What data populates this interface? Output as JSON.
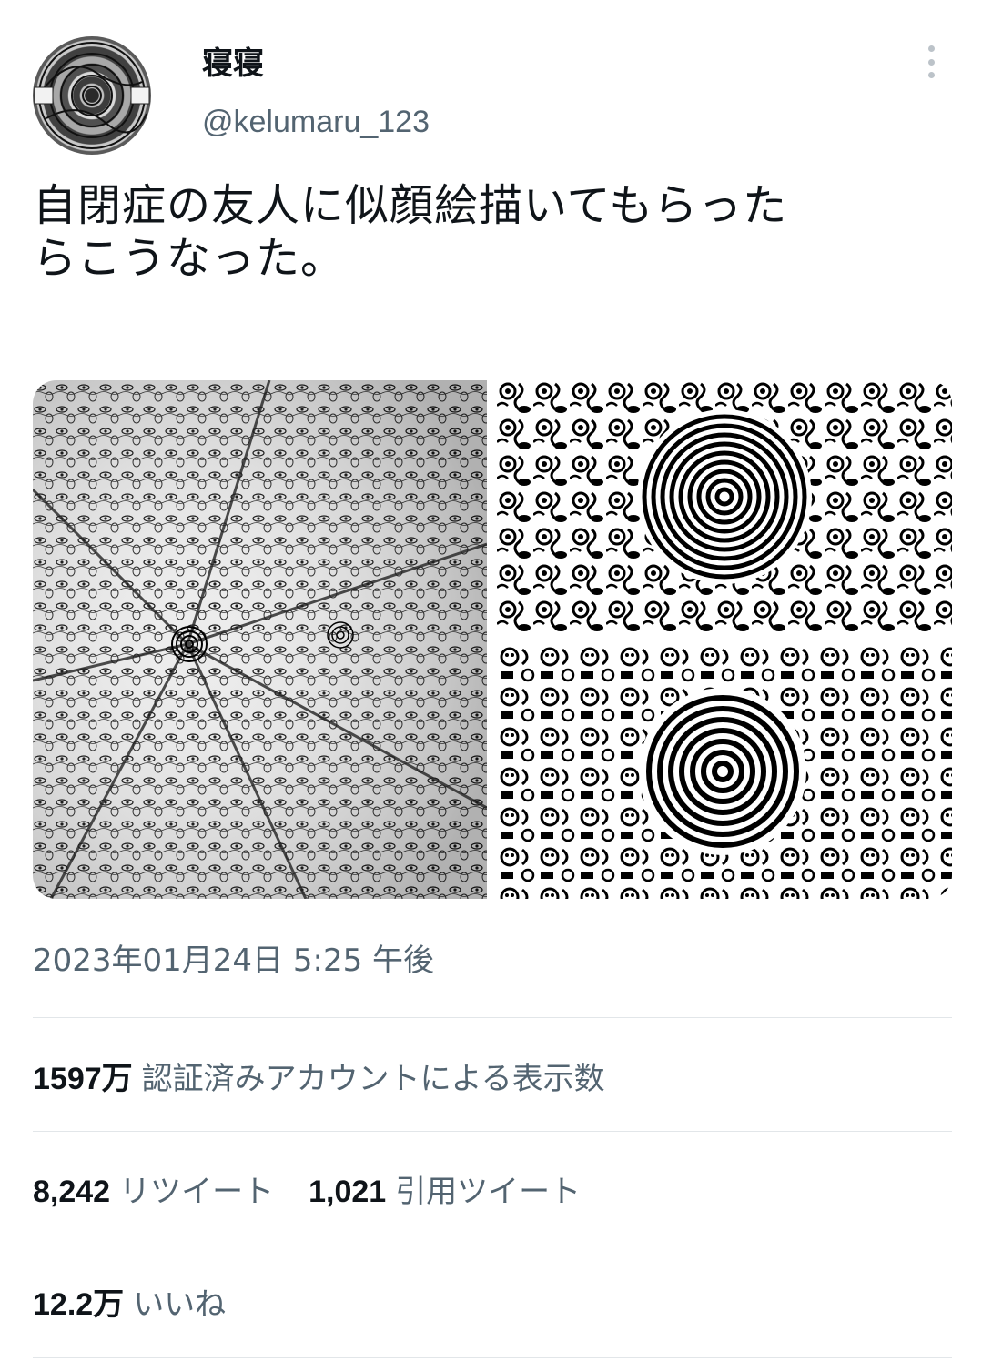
{
  "user": {
    "display_name": "寝寝",
    "handle": "@kelumaru_123"
  },
  "tweet": {
    "text_lines": [
      "自閉症の友人に似顔絵描いてもらった",
      "らこうなった。"
    ]
  },
  "media": [
    {
      "description_icon": "drawing-full-view"
    },
    {
      "description_icon": "drawing-spiral-closeup-1"
    },
    {
      "description_icon": "drawing-spiral-closeup-2"
    }
  ],
  "timestamp": "2023年01月24日 5:25 午後",
  "stats": {
    "views_count": "1597万",
    "views_label": "認証済みアカウントによる表示数",
    "retweets_count": "8,242",
    "retweets_label": "リツイート",
    "quotes_count": "1,021",
    "quotes_label": "引用ツイート",
    "likes_count": "12.2万",
    "likes_label": "いいね"
  },
  "colors": {
    "text_primary": "#0f1419",
    "text_secondary": "#536471",
    "divider": "#e2e6e9"
  }
}
